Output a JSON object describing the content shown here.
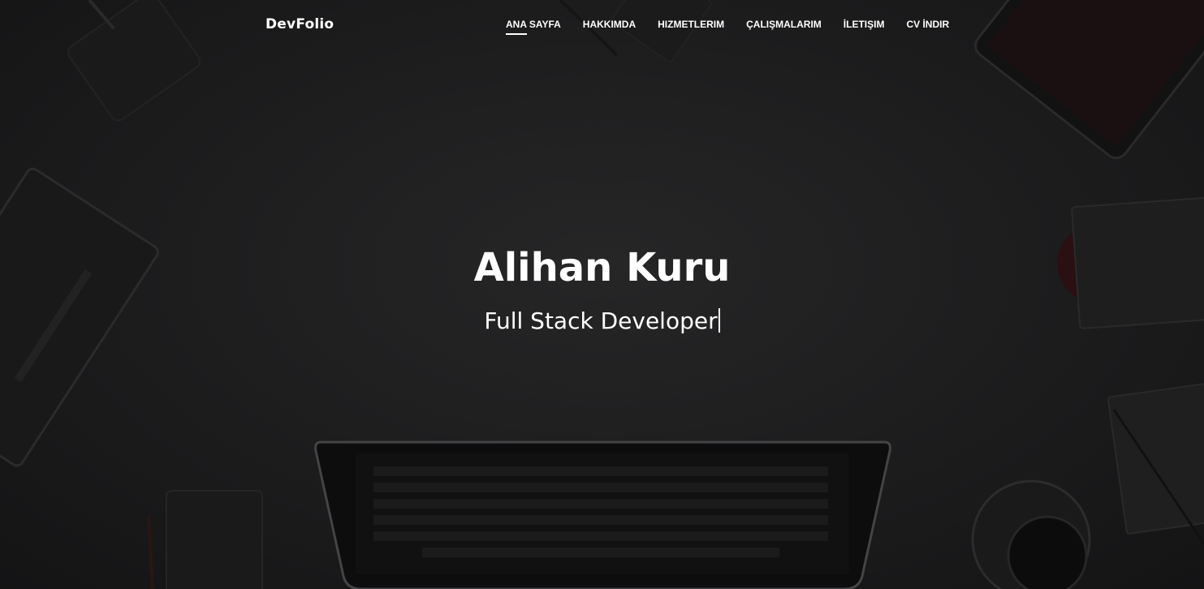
{
  "brand": {
    "name": "DevFolio"
  },
  "nav": {
    "items": [
      {
        "label": "ANA SAYFA",
        "active": true
      },
      {
        "label": "HAKKIMDA",
        "active": false
      },
      {
        "label": "HIZMETLERIM",
        "active": false
      },
      {
        "label": "ÇALIŞMALARIM",
        "active": false
      },
      {
        "label": "İLETIŞIM",
        "active": false
      },
      {
        "label": "CV İNDIR",
        "active": false
      }
    ]
  },
  "hero": {
    "title": "Alihan Kuru",
    "subtitle": "Full Stack Developer"
  },
  "colors": {
    "background": "#1c1c1d",
    "text": "#ffffff"
  }
}
